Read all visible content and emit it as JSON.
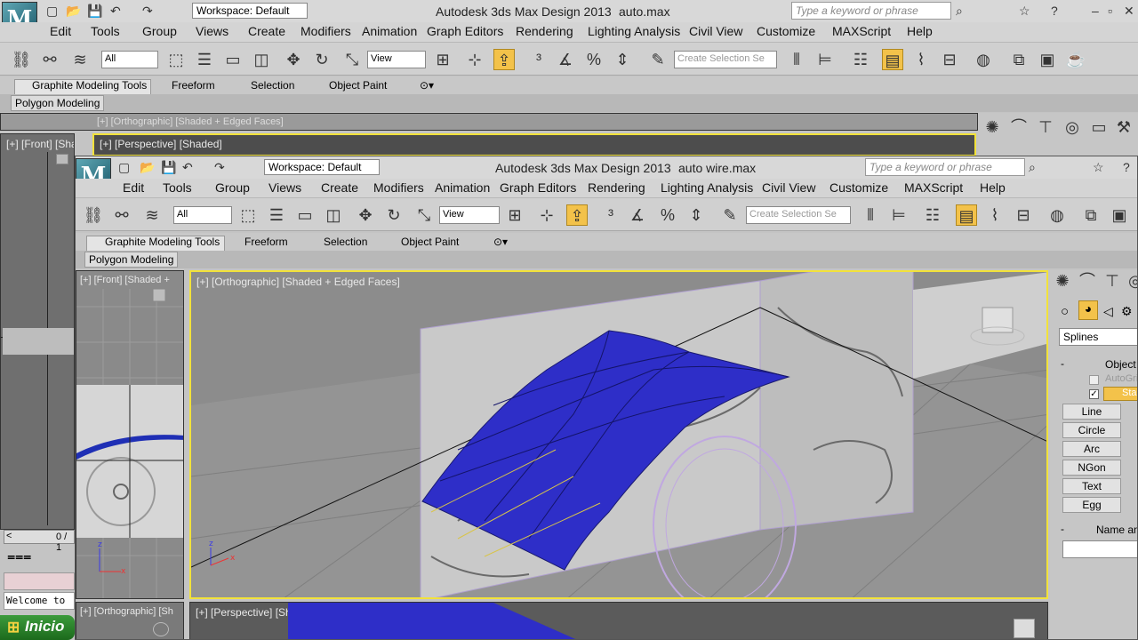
{
  "back_window": {
    "title_app": "Autodesk 3ds Max Design 2013",
    "title_file": "auto.max",
    "workspace": "Workspace: Default",
    "search_placeholder": "Type a keyword or phrase",
    "filter_value": "All",
    "view_value": "View",
    "selection_set_placeholder": "Create Selection Se",
    "ribbon_tabs": [
      "Graphite Modeling Tools",
      "Freeform",
      "Selection",
      "Object Paint"
    ],
    "polygon_modeling": "Polygon Modeling",
    "viewport_ortho_label": "[+] [Orthographic] [Shaded + Edged Faces]",
    "viewport_front_label": "[+] [Front] [Shac",
    "viewport_persp_label": "[+] [Perspective] [Shaded]",
    "timeline_text": "0 / 1",
    "welcome_text": "Welcome to",
    "start_label": "Inicio"
  },
  "front_window": {
    "title_app": "Autodesk 3ds Max Design 2013",
    "title_file": "auto wire.max",
    "workspace": "Workspace: Default",
    "search_placeholder": "Type a keyword or phrase",
    "filter_value": "All",
    "view_value": "View",
    "selection_set_placeholder": "Create Selection Se",
    "ribbon_tabs": [
      "Graphite Modeling Tools",
      "Freeform",
      "Selection",
      "Object Paint"
    ],
    "polygon_modeling": "Polygon Modeling",
    "viewport_front_label": "[+] [Front] [Shaded +",
    "viewport_ortho_label": "[+] [Orthographic] [Shaded + Edged Faces]",
    "viewport_bottom_left_label": "[+] [Orthographic] [Sh",
    "viewport_persp_label": "[+] [Perspective] [Shaded]",
    "command_panel": {
      "category": "Splines",
      "rollout_object_type": "Object T",
      "autogrid": "AutoGri",
      "start_new_shape": "Start",
      "buttons": [
        "Line",
        "Circle",
        "Arc",
        "NGon",
        "Text",
        "Egg"
      ],
      "rollout_name": "Name and"
    }
  },
  "menus": [
    "Edit",
    "Tools",
    "Group",
    "Views",
    "Create",
    "Modifiers",
    "Animation",
    "Graph Editors",
    "Rendering",
    "Lighting Analysis",
    "Civil View",
    "Customize",
    "MAXScript",
    "Help"
  ],
  "colors": {
    "surface_blue": "#2e2ec8",
    "active_border": "#f2e23a",
    "highlight": "#f3c24a"
  }
}
